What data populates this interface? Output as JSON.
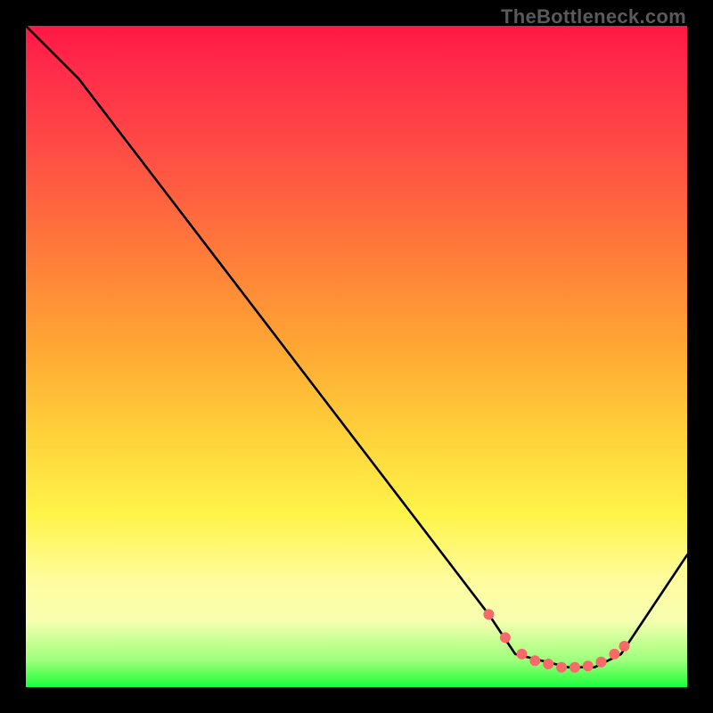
{
  "watermark": "TheBottleneck.com",
  "chart_data": {
    "type": "line",
    "title": "",
    "xlabel": "",
    "ylabel": "",
    "xlim": [
      0,
      100
    ],
    "ylim": [
      0,
      100
    ],
    "grid": false,
    "legend": false,
    "series": [
      {
        "name": "curve",
        "color": "#000000",
        "x": [
          0,
          8,
          70,
          74,
          82,
          86,
          90,
          100
        ],
        "y": [
          100,
          92,
          11,
          5,
          3,
          3,
          5,
          20
        ]
      }
    ],
    "markers": {
      "name": "points",
      "color": "#f86a6a",
      "radius": 6,
      "x": [
        70,
        72.5,
        75,
        77,
        79,
        81,
        83,
        85,
        87,
        89,
        90.5
      ],
      "y": [
        11,
        7.5,
        5,
        4,
        3.5,
        3,
        3,
        3.2,
        3.8,
        5,
        6.2
      ]
    }
  }
}
